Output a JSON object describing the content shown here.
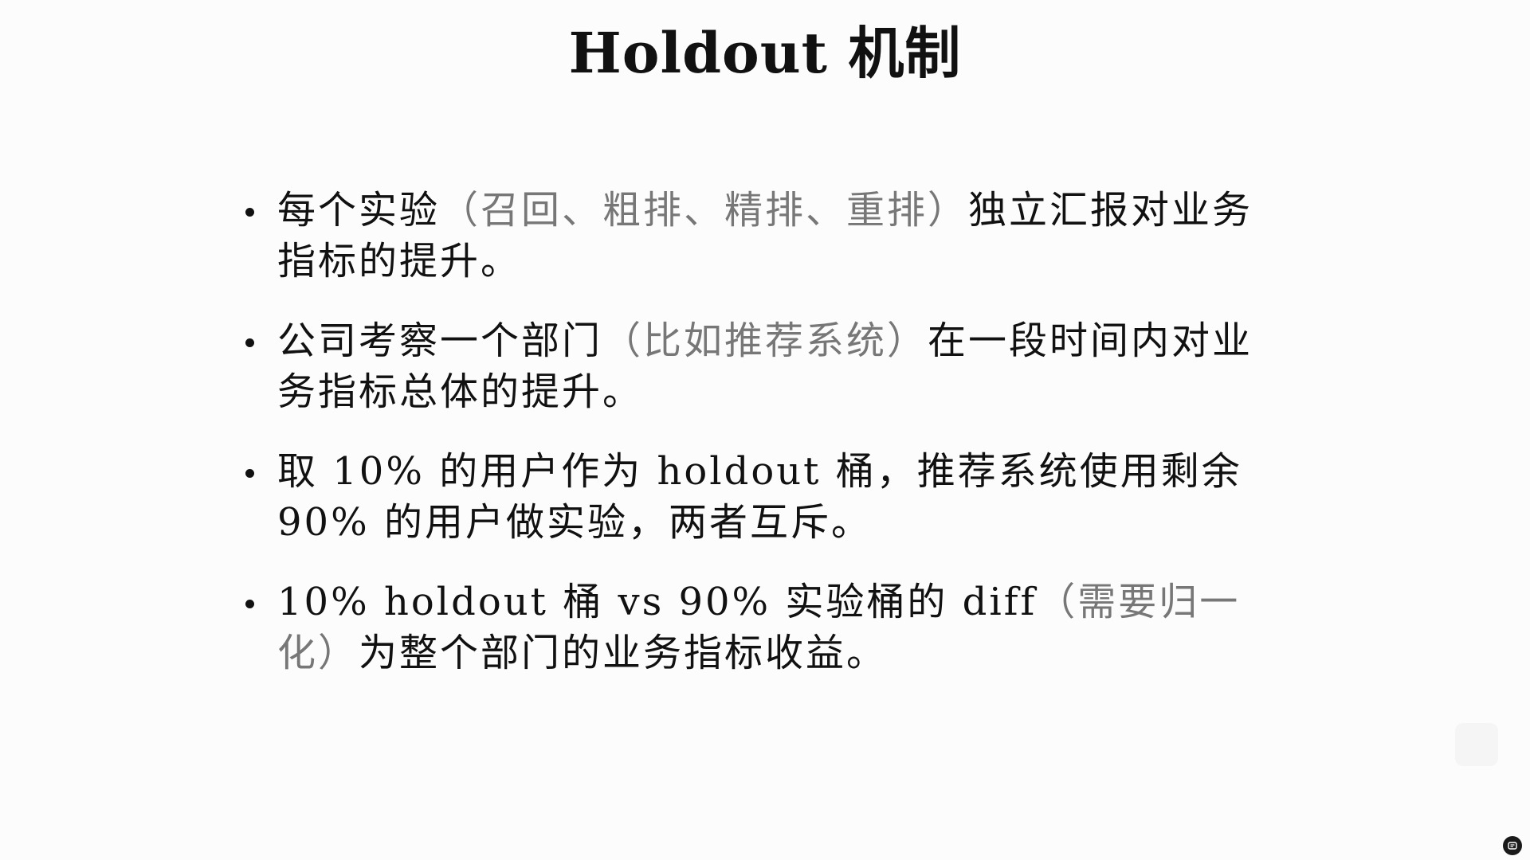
{
  "slide": {
    "title": "Holdout 机制",
    "bullets": [
      {
        "parts": [
          {
            "text": "每个实验",
            "tone": "normal"
          },
          {
            "text": "（召回、粗排、精排、重排）",
            "tone": "gray"
          },
          {
            "text": "独立汇报对业务指标的提升。",
            "tone": "normal"
          }
        ]
      },
      {
        "parts": [
          {
            "text": "公司考察一个部门",
            "tone": "normal"
          },
          {
            "text": "（比如推荐系统）",
            "tone": "gray"
          },
          {
            "text": "在一段时间内对业务指标总体的提升。",
            "tone": "normal"
          }
        ]
      },
      {
        "parts": [
          {
            "text": "取 10% 的用户作为 holdout 桶，推荐系统使用剩余 90% 的用户做实验，两者互斥。",
            "tone": "normal"
          }
        ]
      },
      {
        "parts": [
          {
            "text": "10% holdout 桶 vs 90% 实验桶的 diff",
            "tone": "normal"
          },
          {
            "text": "（需要归一化）",
            "tone": "gray"
          },
          {
            "text": "为整个部门的业务指标收益。",
            "tone": "normal"
          }
        ]
      }
    ]
  },
  "overlay": {
    "corner_icon": "screenshot-tool-icon"
  }
}
